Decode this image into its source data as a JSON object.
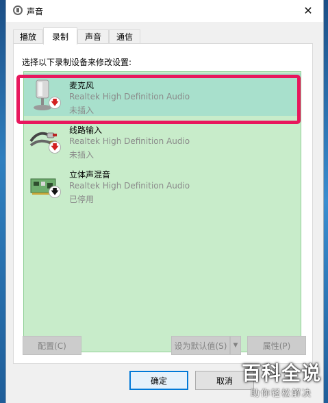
{
  "window": {
    "title": "声音",
    "close_glyph": "✕"
  },
  "tabs": [
    {
      "label": "播放",
      "active": false
    },
    {
      "label": "录制",
      "active": true
    },
    {
      "label": "声音",
      "active": false
    },
    {
      "label": "通信",
      "active": false
    }
  ],
  "instruction": "选择以下录制设备来修改设置:",
  "devices": [
    {
      "name": "麦克风",
      "driver": "Realtek High Definition Audio",
      "status": "未插入",
      "icon": "microphone-icon",
      "badge": "red-down-arrow",
      "selected": true
    },
    {
      "name": "线路输入",
      "driver": "Realtek High Definition Audio",
      "status": "未插入",
      "icon": "line-in-cable-icon",
      "badge": "red-down-arrow",
      "selected": false
    },
    {
      "name": "立体声混音",
      "driver": "Realtek High Definition Audio",
      "status": "已停用",
      "icon": "sound-card-icon",
      "badge": "black-down-arrow",
      "selected": false
    }
  ],
  "buttons": {
    "configure": "配置(C)",
    "set_default": "设为默认值(S)",
    "properties": "属性(P)",
    "ok": "确定",
    "cancel": "取消"
  },
  "watermark": {
    "main": "百科全说",
    "sub": "助你轻松解决"
  },
  "colors": {
    "highlight": "#e8175d",
    "list_bg": "#c8ecca",
    "selected_bg": "#a8e0cc",
    "badge_red": "#d32020"
  }
}
